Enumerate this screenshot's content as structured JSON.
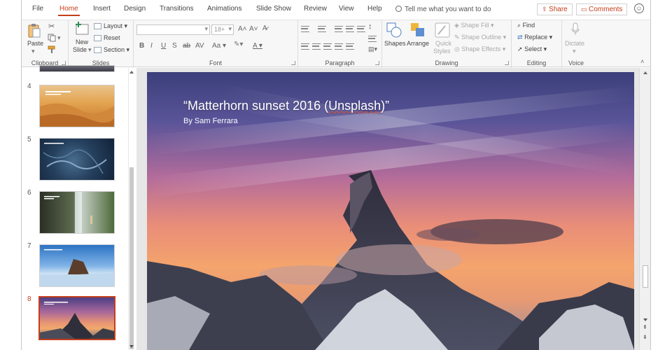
{
  "tabs": [
    "File",
    "Home",
    "Insert",
    "Design",
    "Transitions",
    "Animations",
    "Slide Show",
    "Review",
    "View",
    "Help"
  ],
  "active_tab": "Home",
  "tell_me": "Tell me what you want to do",
  "share": "Share",
  "comments": "Comments",
  "ribbon": {
    "clipboard": {
      "label": "Clipboard",
      "paste": "Paste"
    },
    "slides": {
      "label": "Slides",
      "new_slide_1": "New",
      "new_slide_2": "Slide",
      "layout": "Layout",
      "reset": "Reset",
      "section": "Section"
    },
    "font": {
      "label": "Font",
      "size_placeholder": "18+"
    },
    "paragraph": {
      "label": "Paragraph"
    },
    "drawing": {
      "label": "Drawing",
      "shapes": "Shapes",
      "arrange": "Arrange",
      "quick_1": "Quick",
      "quick_2": "Styles",
      "shape_fill": "Shape Fill",
      "shape_outline": "Shape Outline",
      "shape_effects": "Shape Effects"
    },
    "editing": {
      "label": "Editing",
      "find": "Find",
      "replace": "Replace",
      "select": "Select"
    },
    "voice": {
      "label": "Voice",
      "dictate": "Dictate"
    }
  },
  "thumbnails": [
    {
      "num": "4",
      "caption": ""
    },
    {
      "num": "5",
      "caption": ""
    },
    {
      "num": "6",
      "caption": ""
    },
    {
      "num": "7",
      "caption": ""
    },
    {
      "num": "8",
      "caption": ""
    }
  ],
  "active_slide": "8",
  "slide": {
    "title_open": "“Matterhorn sunset 2016 (",
    "title_squiggle": "Unsplash",
    "title_close": ")”",
    "subtitle": "By Sam Ferrara"
  },
  "colors": {
    "accent": "#c43e1c"
  }
}
